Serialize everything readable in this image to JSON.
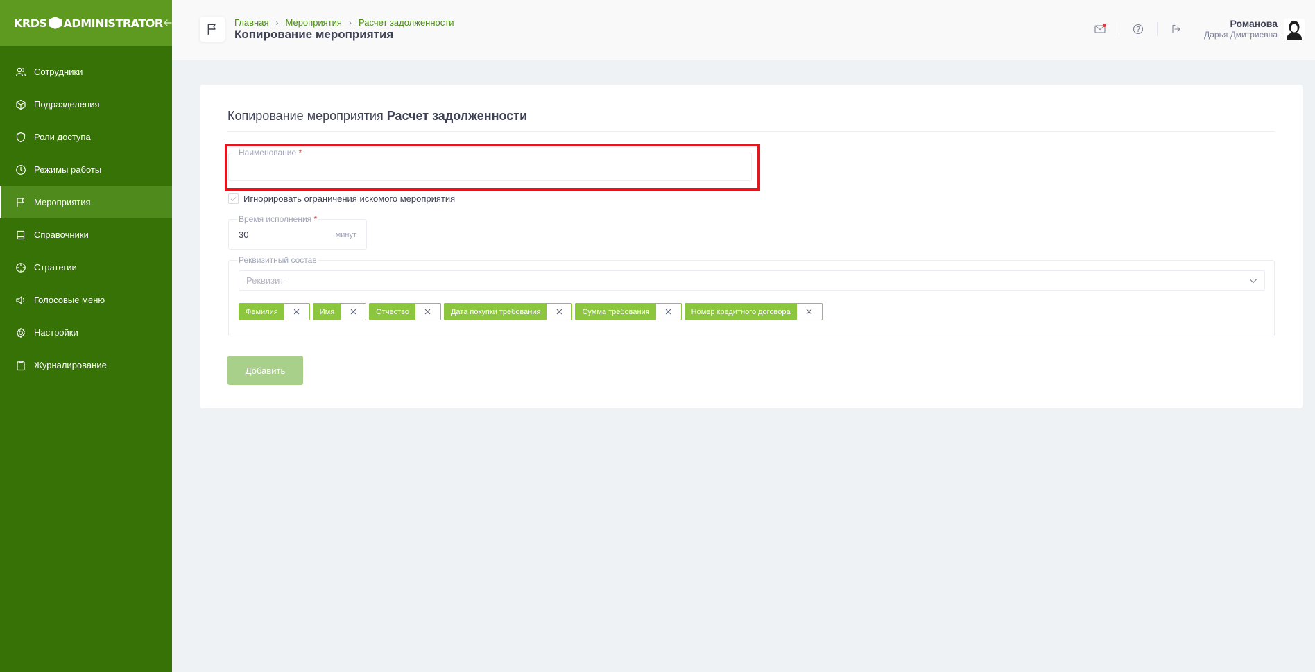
{
  "sidebar": {
    "logo_left": "KRDS",
    "logo_right": "ADMINISTRATOR",
    "items": [
      {
        "label": "Сотрудники",
        "icon": "users-icon"
      },
      {
        "label": "Подразделения",
        "icon": "cube-icon"
      },
      {
        "label": "Роли доступа",
        "icon": "shield-icon"
      },
      {
        "label": "Режимы работы",
        "icon": "clock-icon"
      },
      {
        "label": "Мероприятия",
        "icon": "flag-icon",
        "active": true
      },
      {
        "label": "Справочники",
        "icon": "book-icon"
      },
      {
        "label": "Стратегии",
        "icon": "crosshair-icon"
      },
      {
        "label": "Голосовые меню",
        "icon": "speaker-icon"
      },
      {
        "label": "Настройки",
        "icon": "gear-icon"
      },
      {
        "label": "Журналирование",
        "icon": "clipboard-icon"
      }
    ]
  },
  "header": {
    "breadcrumb": [
      "Главная",
      "Мероприятия",
      "Расчет задолженности"
    ],
    "title": "Копирование мероприятия",
    "user": {
      "last_name": "Романова",
      "first_name": "Дарья Дмитриевна"
    }
  },
  "form": {
    "title_prefix": "Копирование мероприятия",
    "title_name": "Расчет задолженности",
    "name_label": "Наименование",
    "name_value": "",
    "required_mark": "*",
    "ignore_checkbox_label": "Игнорировать ограничения искомого мероприятия",
    "ignore_checked": true,
    "time_label": "Время исполнения",
    "time_value": "30",
    "time_unit": "минут",
    "requisites_label": "Реквизитный состав",
    "requisite_placeholder": "Реквизит",
    "tags": [
      "Фемилия",
      "Имя",
      "Отчество",
      "Дата покупки требования",
      "Сумма требования",
      "Номер кредитного договора"
    ],
    "submit_label": "Добавить"
  },
  "colors": {
    "sidebar_bg": "#367205",
    "accent": "#8cc63e",
    "highlight": "#e3151e"
  }
}
